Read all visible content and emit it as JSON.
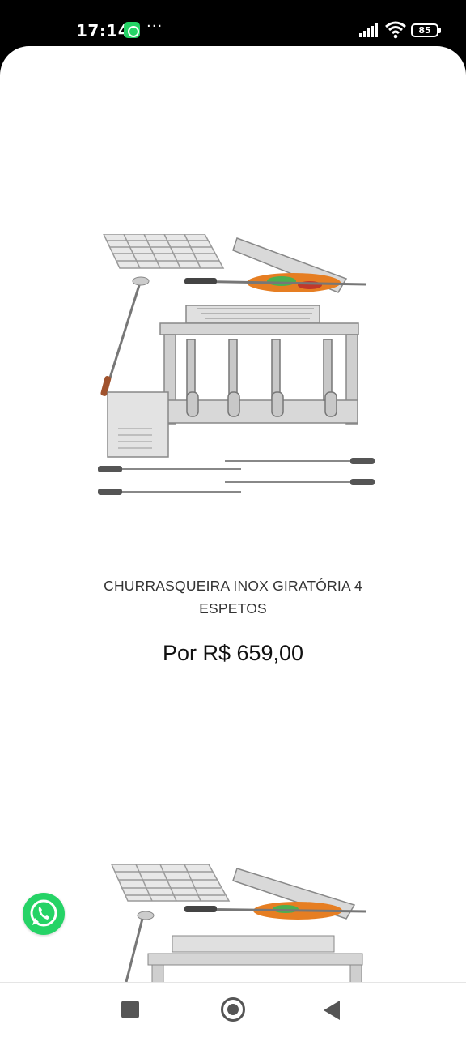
{
  "status_bar": {
    "time": "17:14",
    "notification_icons": [
      "whatsapp-icon"
    ],
    "more": "···",
    "battery": "85"
  },
  "product": {
    "name_line1": "CHURRASQUEIRA INOX GIRATÓRIA 4",
    "name_line2": "ESPETOS",
    "price": "Por R$ 659,00"
  },
  "colors": {
    "whatsapp": "#25D366",
    "nav_icons": "#555555"
  },
  "nav": {
    "buttons": [
      "recent-apps",
      "home",
      "back"
    ]
  }
}
